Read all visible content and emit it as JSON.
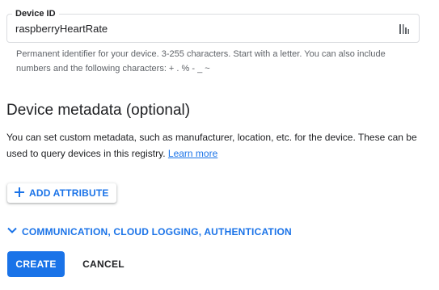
{
  "device_id_field": {
    "label": "Device ID",
    "value": "raspberryHeartRate",
    "trailing_icon": "key-icon",
    "helper_text": "Permanent identifier for your device. 3-255 characters. Start with a letter. You can also include numbers and the following characters: + . % - _ ~"
  },
  "metadata_section": {
    "title": "Device metadata (optional)",
    "description": "You can set custom metadata, such as manufacturer, location, etc. for the device. These can be used to query devices in this registry.",
    "learn_more_label": "Learn more",
    "add_attribute_label": "ADD ATTRIBUTE",
    "add_attribute_icon": "plus-icon"
  },
  "expander": {
    "label": "COMMUNICATION, CLOUD LOGGING, AUTHENTICATION",
    "icon": "chevron-down-icon"
  },
  "actions": {
    "create_label": "CREATE",
    "cancel_label": "CANCEL"
  },
  "colors": {
    "accent": "#1a73e8",
    "text_primary": "#202124",
    "text_secondary": "#5f6368",
    "border": "#dadce0"
  }
}
